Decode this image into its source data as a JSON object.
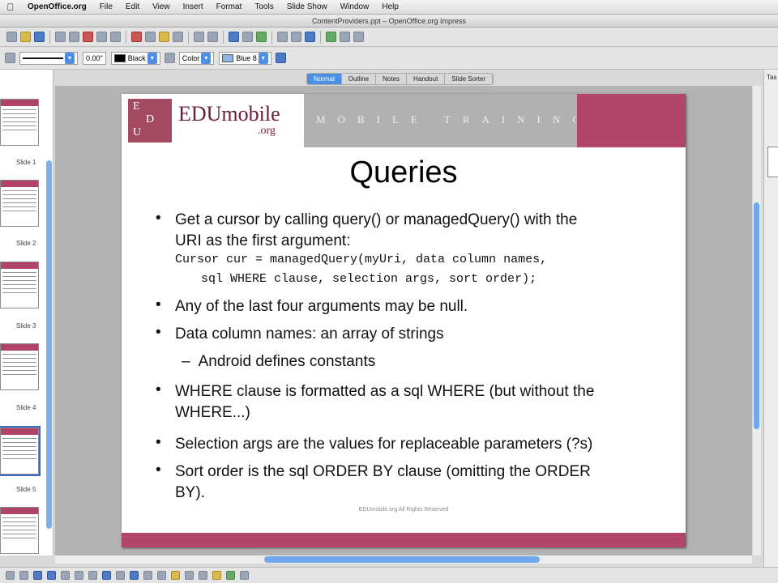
{
  "menubar": {
    "app": "OpenOffice.org",
    "items": [
      "File",
      "Edit",
      "View",
      "Insert",
      "Format",
      "Tools",
      "Slide Show",
      "Window",
      "Help"
    ]
  },
  "window": {
    "title": "ContentProviders.ppt – OpenOffice.org Impress"
  },
  "toolbar2": {
    "line_width": "0.00\"",
    "line_color": "Black",
    "area_style": "Color",
    "area_color": "Blue 8",
    "line_color_hex": "#000000",
    "area_color_hex": "#8db3e2"
  },
  "view_tabs": [
    "Normal",
    "Outline",
    "Notes",
    "Handout",
    "Slide Sorter"
  ],
  "active_view": "Normal",
  "slide_pane": {
    "labels": [
      "Slide 1",
      "Slide 2",
      "Slide 3",
      "Slide 4",
      "Slide 5"
    ],
    "selected": "Slide 5"
  },
  "task_pane": {
    "title": "Tas"
  },
  "slide": {
    "brand_letters": [
      "E",
      "D",
      "U"
    ],
    "brand_name": "EDUmobile",
    "brand_org": ".org",
    "band_text": "MOBILE TRAINING",
    "title": "Queries",
    "bullets": {
      "b1_line1": "Get a cursor by calling query() or managedQuery() with the",
      "b1_line2": "URI as the first argument:",
      "code_line1": "Cursor cur = managedQuery(myUri, data column names,",
      "code_line2": "sql WHERE clause, selection args, sort order);",
      "b2": "Any of the last four arguments may be null.",
      "b3": "Data column names: an array of strings",
      "b3_sub": "Android defines constants",
      "b4_line1": "WHERE clause is formatted as a sql WHERE (but without the",
      "b4_line2": "WHERE...)",
      "b5": "Selection args are the values for replaceable parameters (?s)",
      "b6_line1": "Sort order is the sql ORDER BY clause (omitting the ORDER",
      "b6_line2": "BY)."
    },
    "bullet_glyph": "•",
    "sub_glyph": "–",
    "footer": "EDUmobile.org All Rights Reserved",
    "colors": {
      "brand": "#a34a62",
      "band_grey": "#b1b1b1",
      "band_pink": "#b2456a"
    }
  },
  "icons": {
    "toolbar1": [
      "new-icon",
      "open-icon",
      "save-icon",
      "email-icon",
      "edit-file-icon",
      "pdf-icon",
      "print-icon",
      "spellcheck-icon",
      "cut-icon",
      "copy-icon",
      "paste-icon",
      "clone-icon",
      "undo-icon",
      "redo-icon",
      "chart-icon",
      "table-icon",
      "hyperlink-icon",
      "navigator-icon",
      "zoom-icon",
      "help-icon",
      "slide-icon",
      "layout-icon",
      "design-icon"
    ],
    "drawbar": [
      "select-icon",
      "line-icon",
      "rectangle-icon",
      "ellipse-icon",
      "text-icon",
      "curve-icon",
      "connector-icon",
      "shapes-icon",
      "symbol-icon",
      "arrow-icon",
      "flowchart-icon",
      "callout-icon",
      "star-icon",
      "points-icon",
      "fontwork-icon",
      "from-file-icon",
      "gallery-icon",
      "extrusion-icon"
    ]
  }
}
